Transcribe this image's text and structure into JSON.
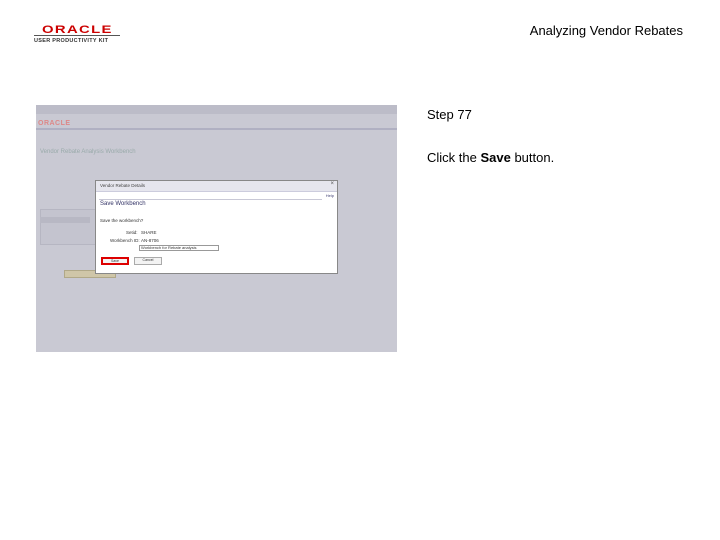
{
  "header": {
    "logo_main": "ORACLE",
    "logo_sub": "USER PRODUCTIVITY KIT",
    "doc_title": "Analyzing Vendor Rebates"
  },
  "screenshot": {
    "brand": "ORACLE",
    "page_title": "Vendor Rebate Analysis Workbench",
    "modal": {
      "window_title": "Vendor Rebate Details",
      "close": "×",
      "help": "Help",
      "heading": "Save Workbench",
      "message": "Save the workbench?",
      "field1_label": "Setid:",
      "field1_value": "SHARE",
      "field2_label": "Workbench ID:",
      "field2_value": "AN-8706",
      "input_value": "Workbench for Rebate analysis",
      "save_label": "Save",
      "cancel_label": "Cancel"
    }
  },
  "instructions": {
    "step": "Step 77",
    "prefix": "Click the ",
    "bold": "Save",
    "suffix": " button."
  }
}
